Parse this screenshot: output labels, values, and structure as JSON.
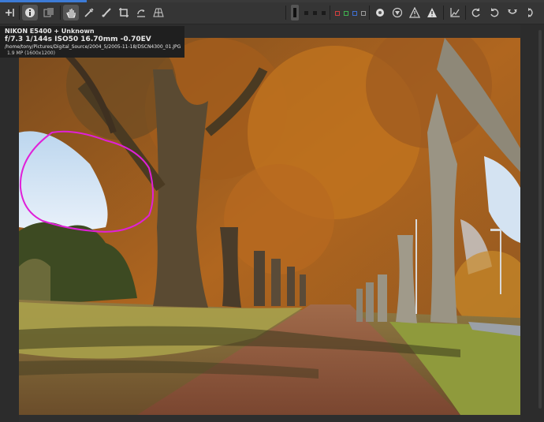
{
  "toolbar": {
    "buttons": [
      {
        "name": "add-to-tree-button",
        "icon": "add-plus-icon",
        "active": false
      },
      {
        "name": "info-toggle-button",
        "icon": "info-icon",
        "active": true
      },
      {
        "name": "compare-button",
        "icon": "duplicate-icon",
        "active": false
      },
      {
        "name": "hand-tool-button",
        "icon": "hand-icon",
        "active": true
      },
      {
        "name": "color-picker-button",
        "icon": "eyedropper-icon",
        "active": false
      },
      {
        "name": "spot-removal-button",
        "icon": "brush-icon",
        "active": false
      },
      {
        "name": "crop-tool-button",
        "icon": "crop-icon",
        "active": false
      },
      {
        "name": "straighten-tool-button",
        "icon": "rotate-icon",
        "active": false
      },
      {
        "name": "perspective-tool-button",
        "icon": "grid-icon",
        "active": false
      }
    ],
    "preview_modes": [
      {
        "name": "preview-mode-rgb",
        "color": "#222222"
      },
      {
        "name": "preview-mode-r",
        "color": "#d33f3f"
      },
      {
        "name": "preview-mode-g",
        "color": "#3fb34f"
      },
      {
        "name": "preview-mode-b",
        "color": "#3f6fd3"
      },
      {
        "name": "preview-mode-l",
        "color": "#9a9a9a"
      }
    ],
    "right_buttons": [
      {
        "name": "focus-mask-button",
        "icon": "circle-icon"
      },
      {
        "name": "shadow-clip-button",
        "icon": "triangle-down-icon"
      },
      {
        "name": "warning-button",
        "icon": "warning-triangle-icon"
      },
      {
        "name": "highlight-clip-button",
        "icon": "warning-filled-icon"
      },
      {
        "name": "histogram-button",
        "icon": "histogram-icon"
      },
      {
        "name": "rotate-left-button",
        "icon": "rotate-left-icon"
      },
      {
        "name": "rotate-right-button",
        "icon": "rotate-right-icon"
      },
      {
        "name": "flip-horizontal-button",
        "icon": "flip-icon"
      },
      {
        "name": "flip-vertical-button",
        "icon": "flip-vertical-icon"
      }
    ]
  },
  "info": {
    "camera": "NIKON E5400 + Unknown",
    "aperture": "f/7.3",
    "shutter": "1/144s",
    "iso": "ISO50",
    "focal": "16.70mm",
    "ev": "-0.70EV",
    "path": "/home/tony/Pictures/Digital_Source/2004_5/2005-11-18/DSCN4300_01.JPG",
    "size": "1.9 MP (1600x1200)"
  },
  "image": {
    "annotation_color": "#e020d8"
  }
}
